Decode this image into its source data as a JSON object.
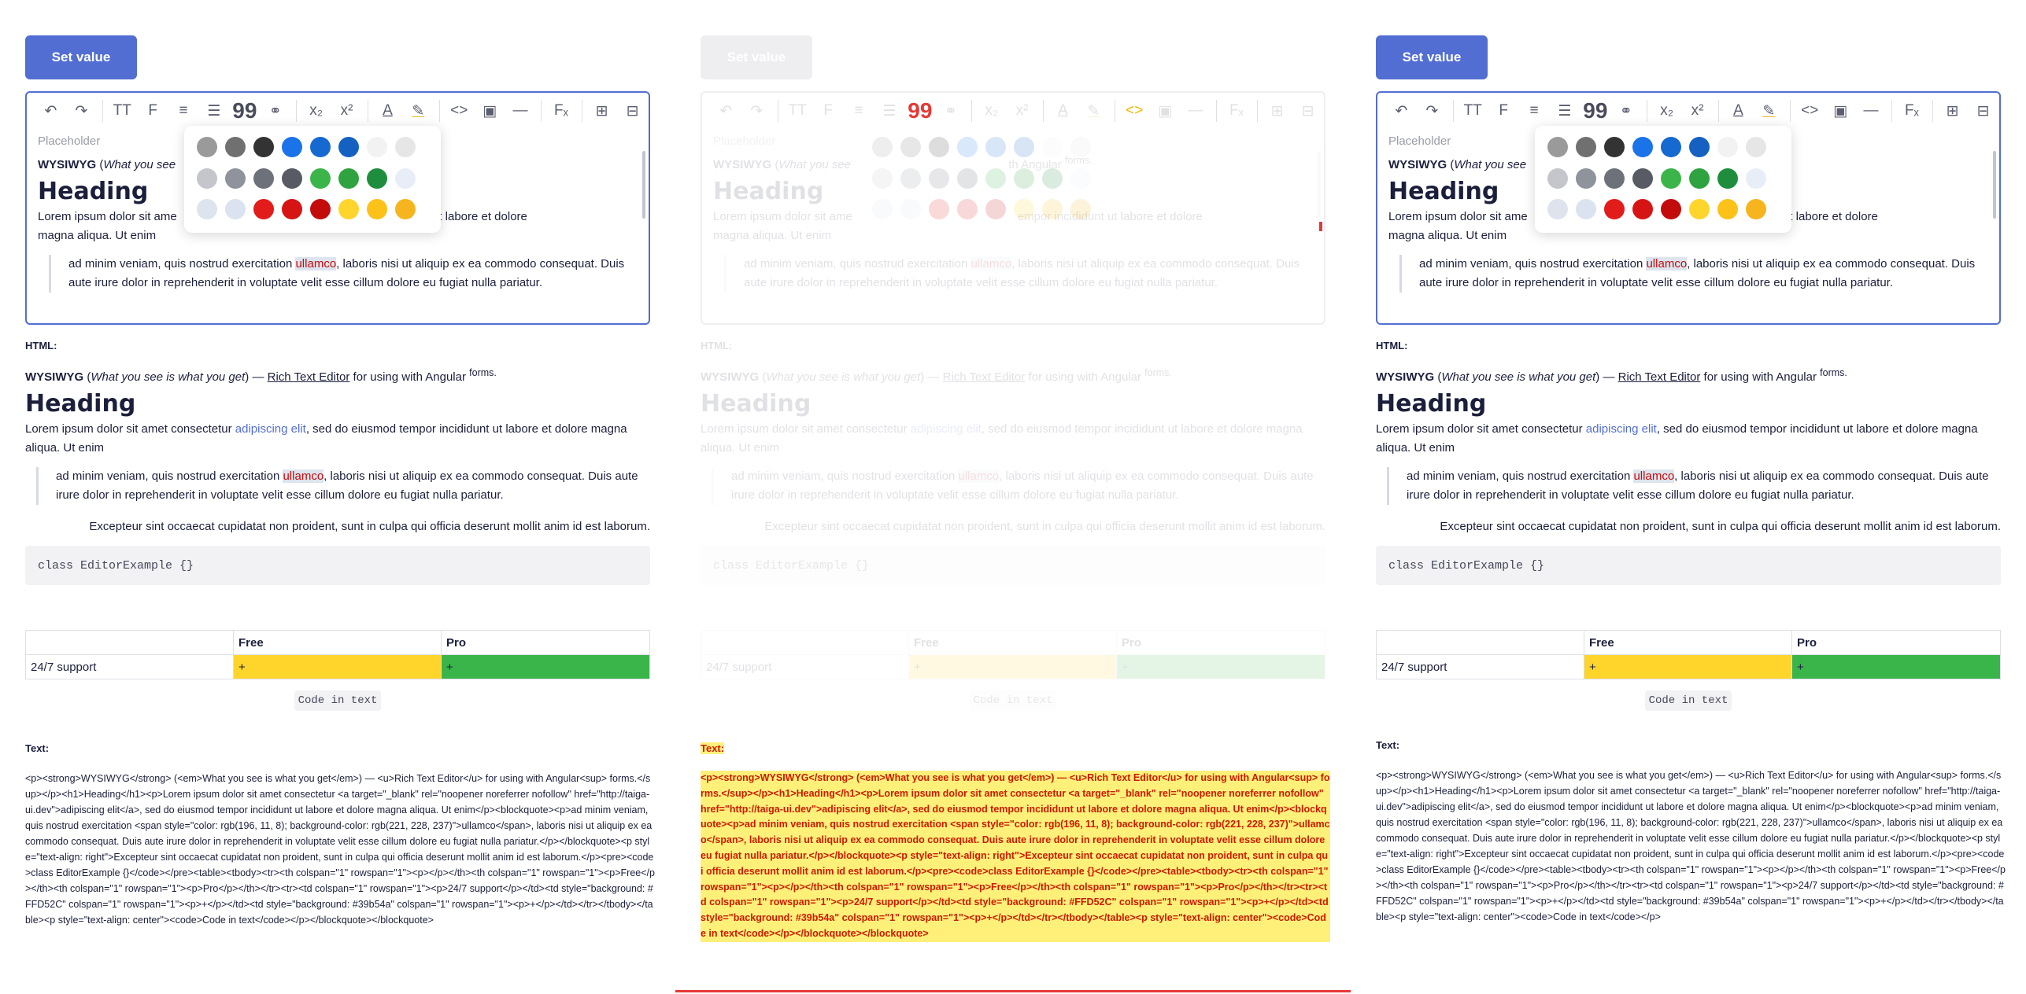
{
  "set_value_label": "Set value",
  "toolbar": {
    "undo": "↶",
    "redo": "↷",
    "font_size": "TT",
    "font": "F",
    "align": "≡",
    "list": "☰",
    "quote": "99",
    "link": "⚭",
    "subscript": "x₂",
    "superscript": "x²",
    "fore_color": "A",
    "back_color": "✎",
    "code": "<>",
    "image": "▣",
    "hr": "—",
    "clear": "Fₓ",
    "table": "⊞",
    "row": "⊟"
  },
  "palette_colors": [
    "#9a9a9a",
    "#707070",
    "#333333",
    "#1a73e8",
    "#1669d1",
    "#1461c2",
    "#f2f2f2",
    "#e6e6e6",
    "#c4c6cc",
    "#8f939c",
    "#6d717a",
    "#585b63",
    "#3bb54a",
    "#2ea340",
    "#1e8e3e",
    "#e8eef8",
    "#dde4ed",
    "#dbe3f0",
    "#e21b1b",
    "#d61414",
    "#c40b0b",
    "#ffd52c",
    "#fcc21a",
    "#f6b51e"
  ],
  "editor": {
    "placeholder": "Placeholder",
    "line1_strong": "WYSIWYG",
    "line1_em": "What you see",
    "line1_tail": "th Angular",
    "line1_sup": "forms.",
    "heading": "Heading",
    "para_start": "Lorem ipsum dolor sit ame",
    "para_end": "empor incididunt ut labore et dolore",
    "para_line2": "magna aliqua. Ut enim",
    "quote_pre": "ad minim veniam, quis nostrud exercitation ",
    "quote_hl": "ullamco",
    "quote_post": ", laboris nisi ut aliquip ex ea commodo consequat. Duis aute irure dolor in reprehenderit in voluptate velit esse cillum dolore eu fugiat nulla pariatur."
  },
  "html_label": "HTML:",
  "preview": {
    "strong": "WYSIWYG",
    "em": "What you see is what you get",
    "dash": " — ",
    "link_u": "Rich Text Editor",
    "tail": " for using with Angular ",
    "sup": "forms.",
    "heading": "Heading",
    "para_pre": "Lorem ipsum dolor sit amet consectetur ",
    "para_link": "adipiscing elit",
    "para_post": ", sed do eiusmod tempor incididunt ut labore et dolore magna aliqua. Ut enim",
    "quote_pre": "ad minim veniam, quis nostrud exercitation ",
    "quote_hl": "ullamco",
    "quote_post": ", laboris nisi ut aliquip ex ea commodo consequat. Duis aute irure dolor in reprehenderit in voluptate velit esse cillum dolore eu fugiat nulla pariatur.",
    "excerpt": "Excepteur sint occaecat cupidatat non proident, sunt in culpa qui officia deserunt mollit anim id est laborum.",
    "code": "class EditorExample {}"
  },
  "table": {
    "head_free": "Free",
    "head_pro": "Pro",
    "row_label": "24/7 support",
    "free_value": "+",
    "pro_value": "+",
    "free_color": "#FFD52C",
    "pro_color": "#39b54a"
  },
  "code_in_text": "Code in text",
  "text_label": "Text:",
  "text_dump": "<p><strong>WYSIWYG</strong> (<em>What you see is what you get</em>) — <u>Rich Text Editor</u> for using with Angular<sup> forms.</sup></p><h1>Heading</h1><p>Lorem ipsum dolor sit amet consectetur <a target=\"_blank\" rel=\"noopener noreferrer nofollow\" href=\"http://taiga-ui.dev\">adipiscing elit</a>, sed do eiusmod tempor incididunt ut labore et dolore magna aliqua. Ut enim</p><blockquote><p>ad minim veniam, quis nostrud exercitation <span style=\"color: rgb(196, 11, 8); background-color: rgb(221, 228, 237)\">ullamco</span>, laboris nisi ut aliquip ex ea commodo consequat. Duis aute irure dolor in reprehenderit in voluptate velit esse cillum dolore eu fugiat nulla pariatur.</p></blockquote><p style=\"text-align: right\">Excepteur sint occaecat cupidatat non proident, sunt in culpa qui officia deserunt mollit anim id est laborum.</p><pre><code>class EditorExample {}</code></pre><table><tbody><tr><th colspan=\"1\" rowspan=\"1\"><p></p></th><th colspan=\"1\" rowspan=\"1\"><p>Free</p></th><th colspan=\"1\" rowspan=\"1\"><p>Pro</p></th></tr><tr><td colspan=\"1\" rowspan=\"1\"><p>24/7 support</p></td><td style=\"background: #FFD52C\" colspan=\"1\" rowspan=\"1\"><p>+</p></td><td style=\"background: #39b54a\" colspan=\"1\" rowspan=\"1\"><p>+</p></td></tr></tbody></table><p style=\"text-align: center\"><code>Code in text</code></p></blockquote></blockquote>",
  "text_dump_right": "<p><strong>WYSIWYG</strong> (<em>What you see is what you get</em>) — <u>Rich Text Editor</u> for using with Angular<sup> forms.</sup></p><h1>Heading</h1><p>Lorem ipsum dolor sit amet consectetur <a target=\"_blank\" rel=\"noopener noreferrer nofollow\" href=\"http://taiga-ui.dev\">adipiscing elit</a>, sed do eiusmod tempor incididunt ut labore et dolore magna aliqua. Ut enim</p><blockquote><p>ad minim veniam, quis nostrud exercitation <span style=\"color: rgb(196, 11, 8); background-color: rgb(221, 228, 237)\">ullamco</span>, laboris nisi ut aliquip ex ea commodo consequat. Duis aute irure dolor in reprehenderit in voluptate velit esse cillum dolore eu fugiat nulla pariatur.</p></blockquote><p style=\"text-align: right\">Excepteur sint occaecat cupidatat non proident, sunt in culpa qui officia deserunt mollit anim id est laborum.</p><pre><code>class EditorExample {}</code></pre><table><tbody><tr><th colspan=\"1\" rowspan=\"1\"><p></p></th><th colspan=\"1\" rowspan=\"1\"><p>Free</p></th><th colspan=\"1\" rowspan=\"1\"><p>Pro</p></th></tr><tr><td colspan=\"1\" rowspan=\"1\"><p>24/7 support</p></td><td style=\"background: #FFD52C\" colspan=\"1\" rowspan=\"1\"><p>+</p></td><td style=\"background: #39b54a\" colspan=\"1\" rowspan=\"1\"><p>+</p></td></tr></tbody></table><p style=\"text-align: center\"><code>Code in text</code></p>"
}
